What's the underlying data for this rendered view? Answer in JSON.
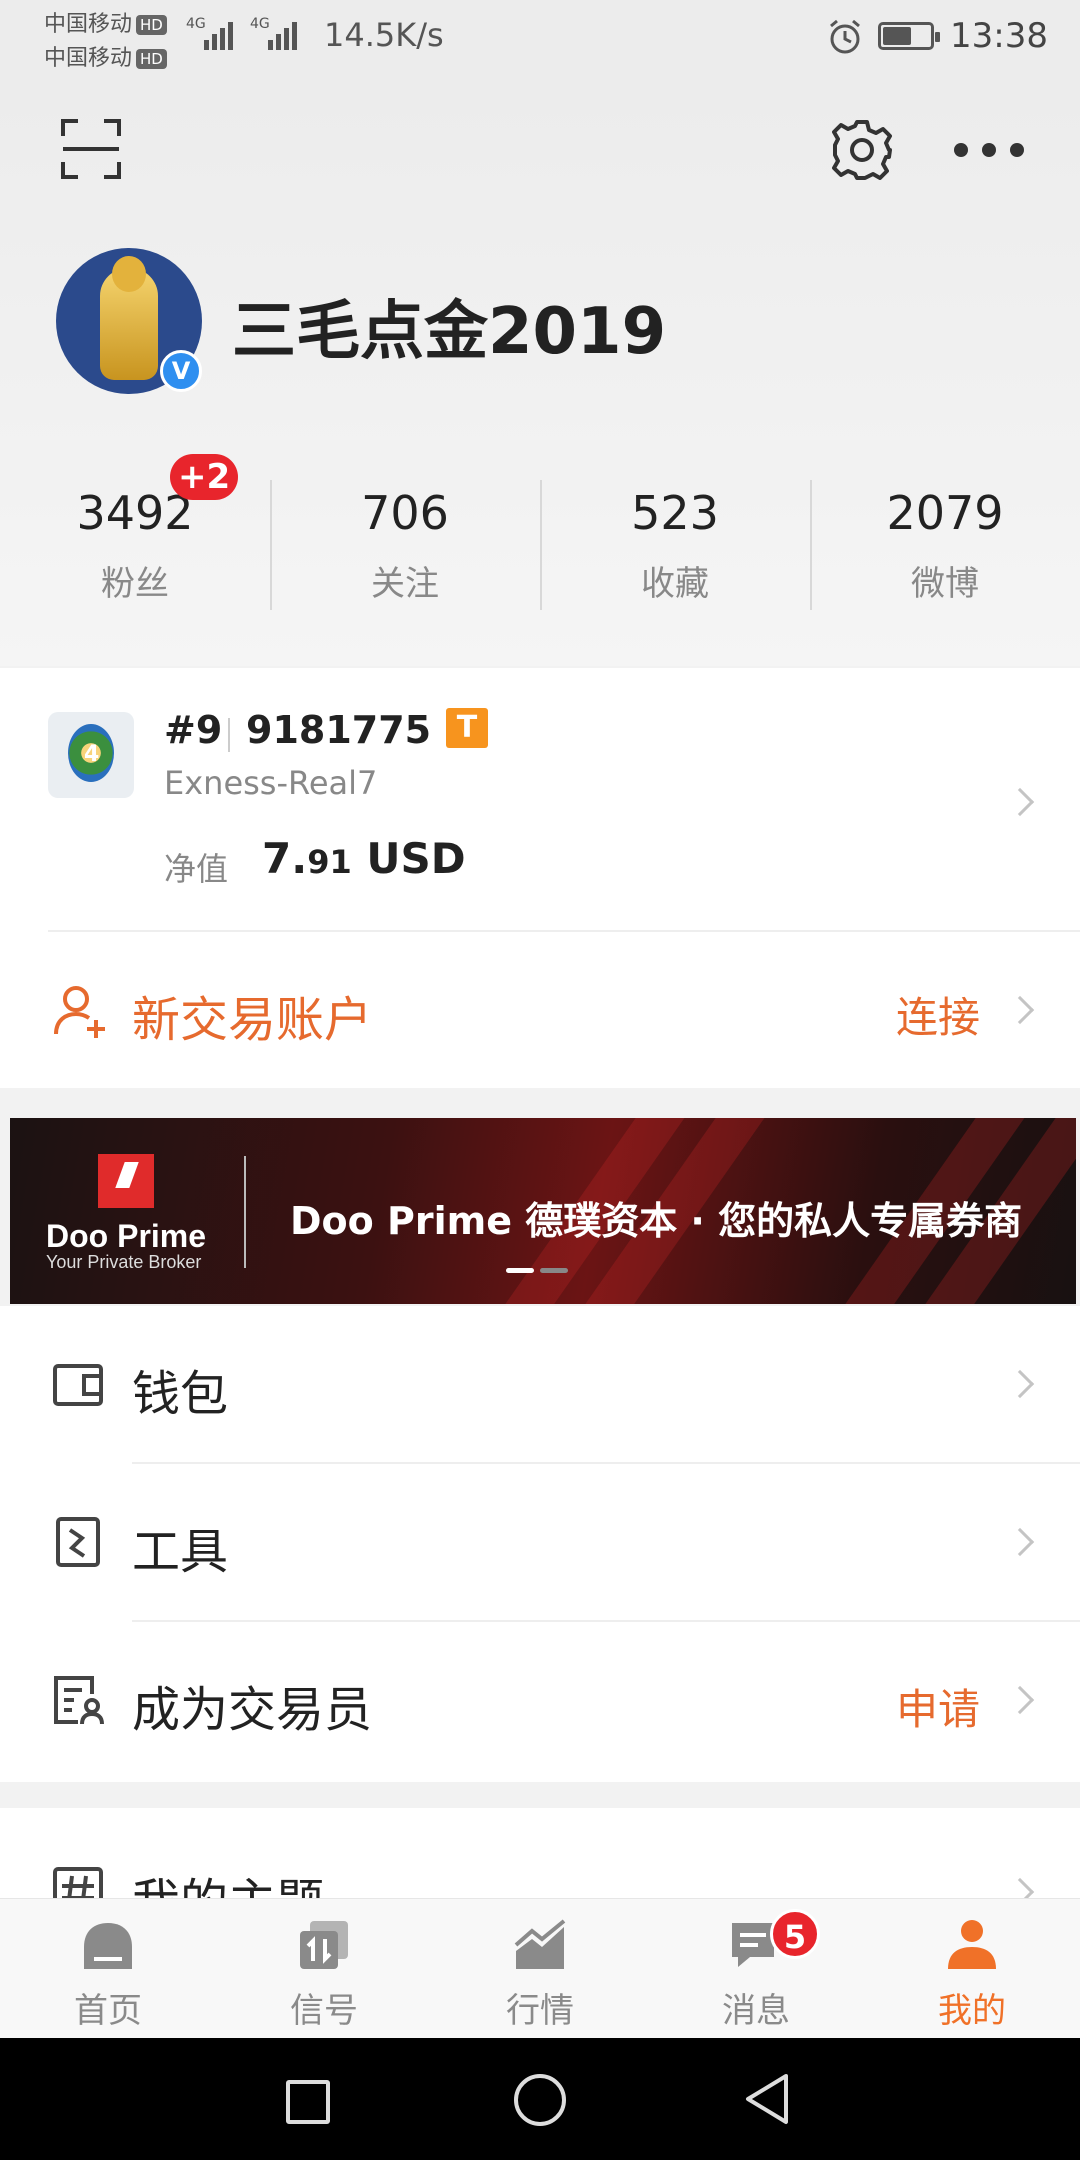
{
  "status_bar": {
    "carrier1": "中国移动",
    "carrier2": "中国移动",
    "hd": "HD",
    "net1": "4G",
    "net2": "4G",
    "net_speed": "14.5K/s",
    "time": "13:38",
    "battery_level": 0.55
  },
  "profile": {
    "username": "三毛点金2019",
    "verified": "V",
    "stats": [
      {
        "value": "3492",
        "label": "粉丝",
        "badge": "+2"
      },
      {
        "value": "706",
        "label": "关注"
      },
      {
        "value": "523",
        "label": "收藏"
      },
      {
        "value": "2079",
        "label": "微博"
      }
    ]
  },
  "account": {
    "logo_text": "4",
    "rank": "#9",
    "number": "9181775",
    "tag": "T",
    "server": "Exness-Real7",
    "equity_label": "净值",
    "equity_main": "7.",
    "equity_decimals": "91",
    "equity_currency": "USD",
    "new_account_label": "新交易账户",
    "connect_label": "连接"
  },
  "banner": {
    "brand_name": "Doo Prime",
    "brand_tagline": "Your Private Broker",
    "slogan": "Doo Prime 德璞资本 · 您的私人专属券商"
  },
  "menu": {
    "wallet": "钱包",
    "tools": "工具",
    "become_trader": "成为交易员",
    "apply": "申请",
    "my_topics": "我的主题"
  },
  "tabs": [
    {
      "label": "首页",
      "icon": "home-icon"
    },
    {
      "label": "信号",
      "icon": "signal-icon"
    },
    {
      "label": "行情",
      "icon": "chart-icon"
    },
    {
      "label": "消息",
      "icon": "message-icon",
      "badge": "5"
    },
    {
      "label": "我的",
      "icon": "person-icon",
      "active": true
    }
  ],
  "colors": {
    "accent": "#f07128",
    "badge": "#e8252c",
    "verified": "#2f8ff0"
  }
}
